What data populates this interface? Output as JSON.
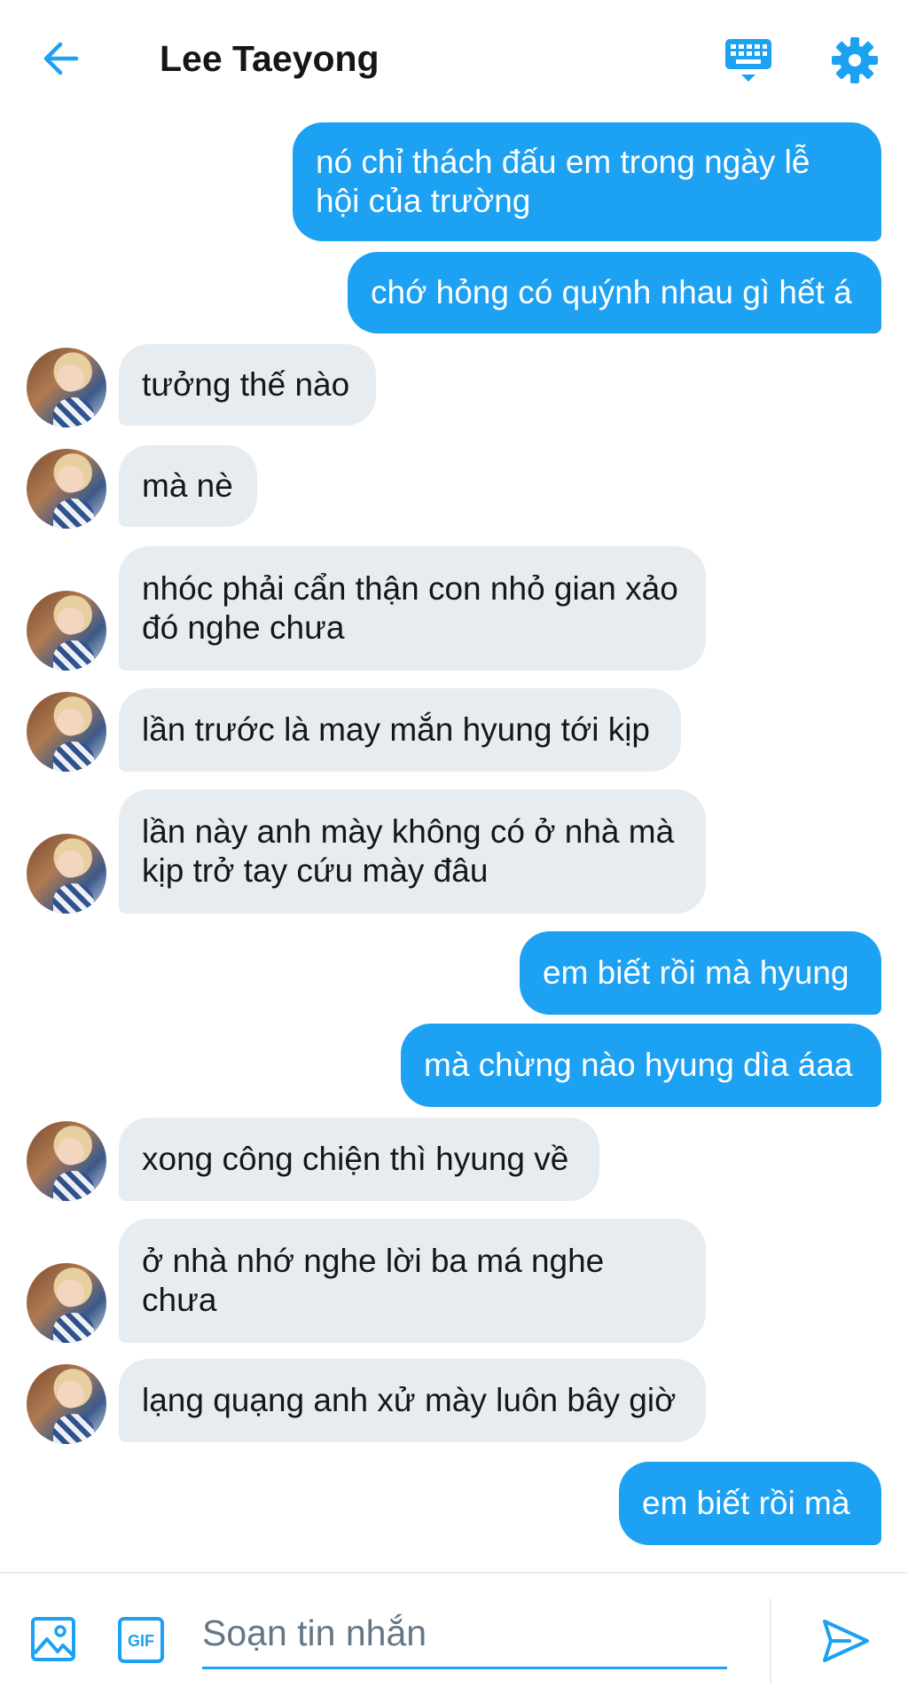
{
  "header": {
    "title": "Lee Taeyong",
    "back_icon": "arrow-left-icon",
    "keyboard_icon": "keyboard-icon",
    "settings_icon": "gear-icon"
  },
  "colors": {
    "accent": "#1da1f2",
    "incoming_bubble": "#e6ecf0",
    "text": "#14171a"
  },
  "messages": [
    {
      "from": "me",
      "text": "nó chỉ thách đấu em trong ngày lễ hội của trường"
    },
    {
      "from": "me",
      "text": "chớ hỏng có quýnh nhau gì hết á"
    },
    {
      "from": "them",
      "text": "tưởng thế nào"
    },
    {
      "from": "them",
      "text": "mà nè"
    },
    {
      "from": "them",
      "text": "nhóc phải cẩn thận con nhỏ gian xảo đó nghe chưa"
    },
    {
      "from": "them",
      "text": "lần trước là may mắn hyung tới kịp"
    },
    {
      "from": "them",
      "text": "lần này anh mày không có ở nhà mà kịp trở tay cứu mày đâu"
    },
    {
      "from": "me",
      "text": "em biết rồi mà hyung"
    },
    {
      "from": "me",
      "text": "mà chừng nào hyung dìa áaa"
    },
    {
      "from": "them",
      "text": "xong công chiện thì hyung về"
    },
    {
      "from": "them",
      "text": "ở nhà nhớ nghe lời ba má nghe chưa"
    },
    {
      "from": "them",
      "text": "lạng quạng anh xử mày luôn bây giờ"
    },
    {
      "from": "me",
      "text": "em biết rồi mà"
    }
  ],
  "composer": {
    "placeholder": "Soạn tin nhắn",
    "value": "",
    "gif_label": "GIF",
    "image_icon": "image-icon",
    "send_icon": "send-icon"
  }
}
